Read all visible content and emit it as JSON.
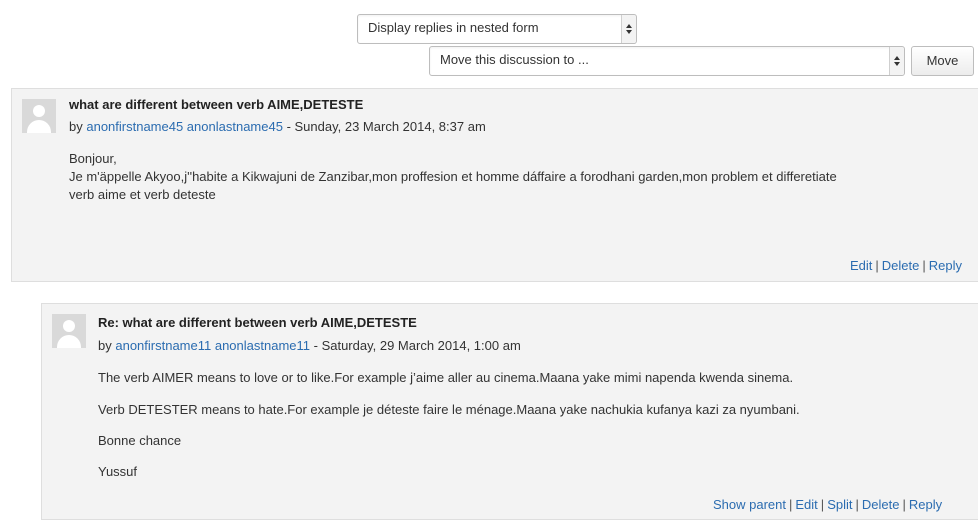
{
  "display_mode_select": {
    "value": "Display replies in nested form"
  },
  "move_select": {
    "value": "Move this discussion to ..."
  },
  "move_button": {
    "label": "Move"
  },
  "posts": [
    {
      "subject": "what are different between verb AIME,DETESTE",
      "by": "by",
      "author": "anonfirstname45 anonlastname45",
      "date": " - Sunday, 23 March 2014, 8:37 am",
      "paragraphs": [
        "Bonjour,",
        "Je m'äppelle Akyoo,j''habite a Kikwajuni de Zanzibar,mon proffesion et homme dáffaire a forodhani garden,mon problem et differetiate",
        "verb aime et verb deteste"
      ],
      "commands": [
        "Edit",
        "Delete",
        "Reply"
      ]
    },
    {
      "subject": "Re: what are different between verb AIME,DETESTE",
      "by": "by",
      "author": "anonfirstname11 anonlastname11",
      "date": " - Saturday, 29 March 2014, 1:00 am",
      "paragraphs": [
        "The verb AIMER means to love or to like.For example j’aime aller au cinema.Maana yake mimi napenda kwenda sinema.",
        "Verb DETESTER means to hate.For example je déteste faire le ménage.Maana yake nachukia kufanya kazi za nyumbani.",
        "Bonne chance",
        "Yussuf"
      ],
      "commands": [
        "Show parent",
        "Edit",
        "Split",
        "Delete",
        "Reply"
      ]
    }
  ]
}
